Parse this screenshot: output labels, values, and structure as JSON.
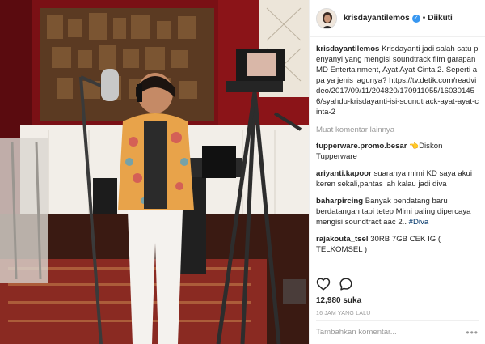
{
  "post": {
    "username": "krisdayantilemos",
    "verified_badge": "✓",
    "separator": "•",
    "follow_status": "Diikuti"
  },
  "caption": {
    "username": "krisdayantilemos",
    "text": "Krisdayanti jadi salah satu penyanyi yang mengisi soundtrack film garapan MD Entertainment, Ayat Ayat Cinta 2. Seperti apa ya jenis lagunya? https://tv.detik.com/readvideo/2017/09/11/204820/170911055/160301456/syahdu-krisdayanti-isi-soundtrack-ayat-ayat-cinta-2"
  },
  "load_more": "Muat komentar lainnya",
  "comments": [
    {
      "user": "tupperware.promo.besar",
      "text": "👈Diskon Tupperware"
    },
    {
      "user": "ariyanti.kapoor",
      "text": "suaranya mimi KD saya akui keren sekali,pantas lah kalau jadi diva"
    },
    {
      "user": "baharpircing",
      "text": "Banyak pendatang baru berdatangan tapi tetep Mimi paling dipercaya mengisi soundtract aac 2..",
      "hashtag": "#Diva"
    },
    {
      "user": "rajakouta_tsel",
      "text": "30RB 7GB CEK IG ( TELKOMSEL )"
    }
  ],
  "actions": {
    "like_icon": "heart-icon",
    "comment_icon": "comment-bubble-icon"
  },
  "likes": "12,980 suka",
  "timestamp": "16 JAM YANG LALU",
  "add_comment": {
    "placeholder": "Tambahkan komentar...",
    "more": "•••"
  },
  "colors": {
    "accent_blue": "#3897f0",
    "hashtag": "#003569",
    "muted": "#999999",
    "text": "#262626",
    "wall_red": "#8b1418"
  }
}
